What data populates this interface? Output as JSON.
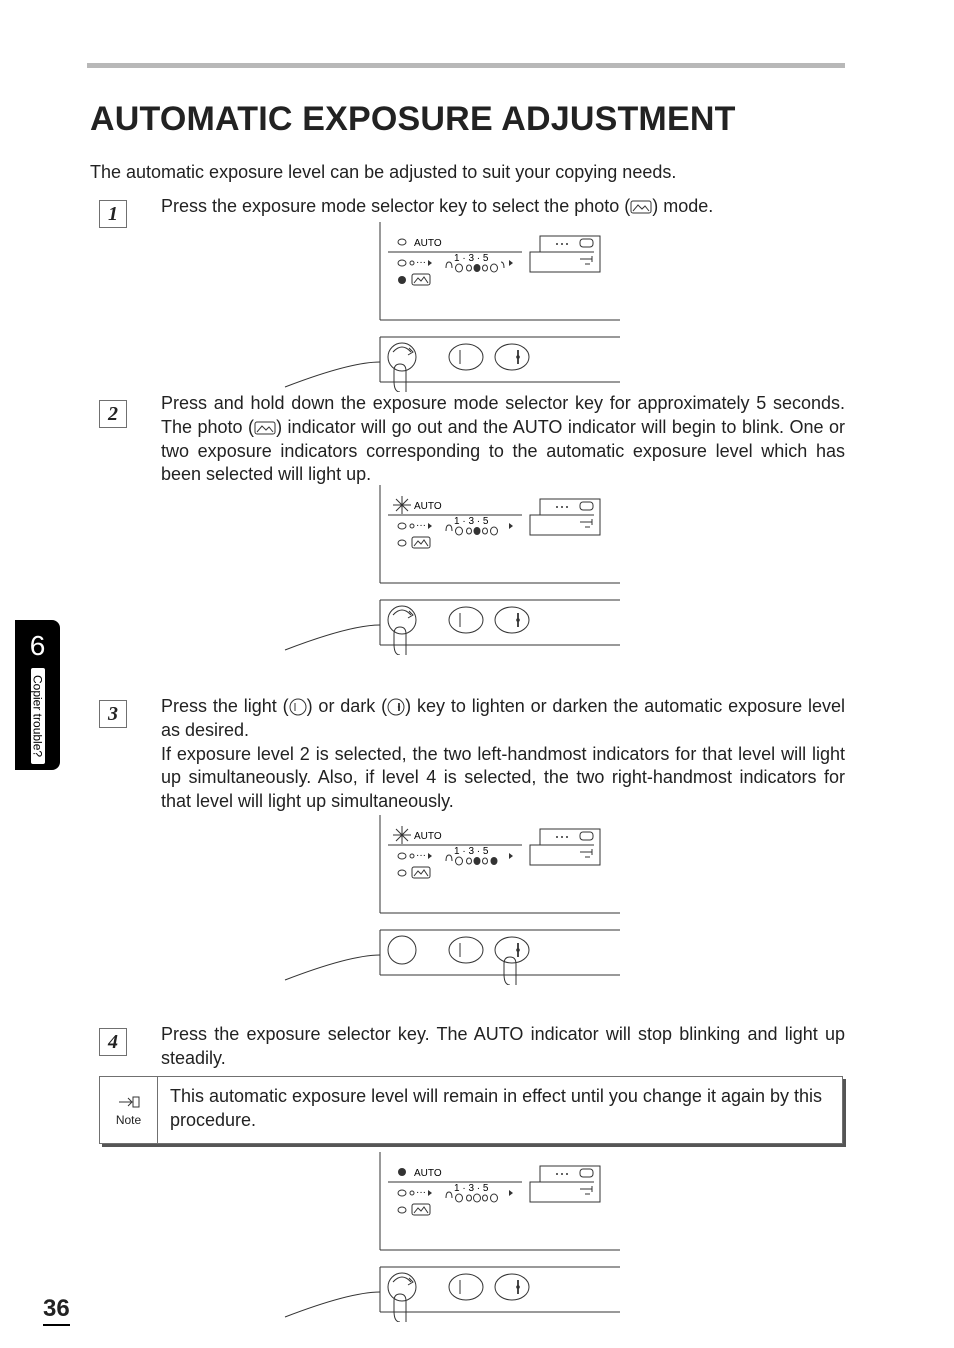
{
  "title": "AUTOMATIC EXPOSURE ADJUSTMENT",
  "intro": "The automatic exposure level can be adjusted to suit your copying needs.",
  "steps": {
    "s1": {
      "num": "1",
      "text_a": "Press the exposure mode selector key to select the photo (",
      "text_b": ") mode."
    },
    "s2": {
      "num": "2",
      "text_a": "Press and hold down the exposure mode selector key for approximately 5 seconds. The photo (",
      "text_b": ") indicator will go out and the AUTO indicator will begin to blink. One or two exposure indicators corresponding to the automatic exposure level which has been selected will light up."
    },
    "s3": {
      "num": "3",
      "text_a": "Press the light (",
      "text_b": ") or dark (",
      "text_c": ") key to lighten or darken the automatic exposure level as desired.",
      "text_d": "If exposure level 2 is selected, the two left-handmost indicators for that level will light up simultaneously. Also, if level 4 is selected, the two right-handmost indicators for that level will light up simultaneously."
    },
    "s4": {
      "num": "4",
      "text": "Press the exposure selector key. The AUTO indicator will stop blinking and light up steadily."
    }
  },
  "note": {
    "label": "Note",
    "text": "This automatic exposure level will remain in effect until you change it again by this procedure."
  },
  "panel": {
    "auto": "AUTO",
    "ticks": "1 · 3 · 5"
  },
  "side": {
    "chapter": "6",
    "label": "Copier trouble?"
  },
  "page": "36"
}
